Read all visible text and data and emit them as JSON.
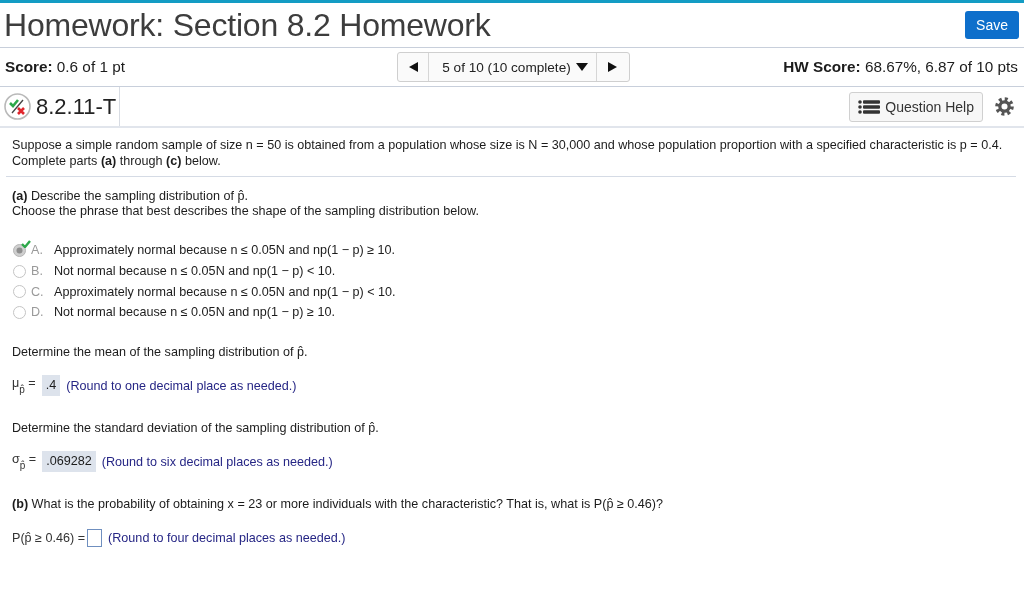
{
  "header": {
    "title": "Homework: Section 8.2 Homework",
    "save_button": "Save"
  },
  "score_bar": {
    "score_label": "Score:",
    "score_value": "0.6 of 1 pt",
    "navigator": {
      "counter": "5 of 10 (10 complete)"
    },
    "hw_score_label": "HW Score:",
    "hw_score_value": "68.67%, 6.87 of 10 pts"
  },
  "question_bar": {
    "correct_mark": true,
    "incorrect_mark": true,
    "question_id": "8.2.11-T",
    "help_button": "Question Help"
  },
  "statement": [
    "Suppose a simple random sample of size n = 50 is obtained from a population whose size is N = 30,000 and whose population proportion with a specified characteristic is p = 0.4.",
    "Complete parts **(a)** through **(c)** below."
  ],
  "items": [
    {
      "kind": "prompt",
      "lines": [
        "**(a)** Describe the sampling distribution of p̂.",
        "Choose the phrase that best describes the shape of the sampling distribution below."
      ]
    },
    {
      "kind": "choices",
      "options": [
        {
          "letter": "A.",
          "text": "Approximately normal because n ≤ 0.05N and np(1 − p) ≥ 10.",
          "selected": true,
          "correct": true
        },
        {
          "letter": "B.",
          "text": "Not normal because n ≤ 0.05N and np(1 − p) < 10.",
          "selected": false,
          "correct": false
        },
        {
          "letter": "C.",
          "text": "Approximately normal because n ≤ 0.05N and np(1 − p) < 10.",
          "selected": false,
          "correct": false
        },
        {
          "letter": "D.",
          "text": "Not normal because n ≤ 0.05N and np(1 − p) ≥ 10.",
          "selected": false,
          "correct": false
        }
      ]
    },
    {
      "kind": "prompt",
      "lines": [
        "Determine the mean of the sampling distribution of p̂."
      ]
    },
    {
      "kind": "answer",
      "label": "μ$_{p̂}$ =",
      "value": ".4",
      "hint": "(Round to one decimal place as needed.)"
    },
    {
      "kind": "prompt",
      "lines": [
        "Determine the standard deviation of the sampling distribution of p̂."
      ]
    },
    {
      "kind": "answer",
      "label": "σ$_{p̂}$ =",
      "value": ".069282",
      "hint": "(Round to six decimal places as needed.)"
    },
    {
      "kind": "prompt",
      "lines": [
        "**(b)** What is the probability of obtaining x = 23 or more individuals with the characteristic? That is, what is P(p̂ ≥ 0.46)?"
      ]
    },
    {
      "kind": "answer",
      "label": "P(p̂ ≥ 0.46) =",
      "hint": "(Round to four decimal places as needed.)"
    }
  ]
}
